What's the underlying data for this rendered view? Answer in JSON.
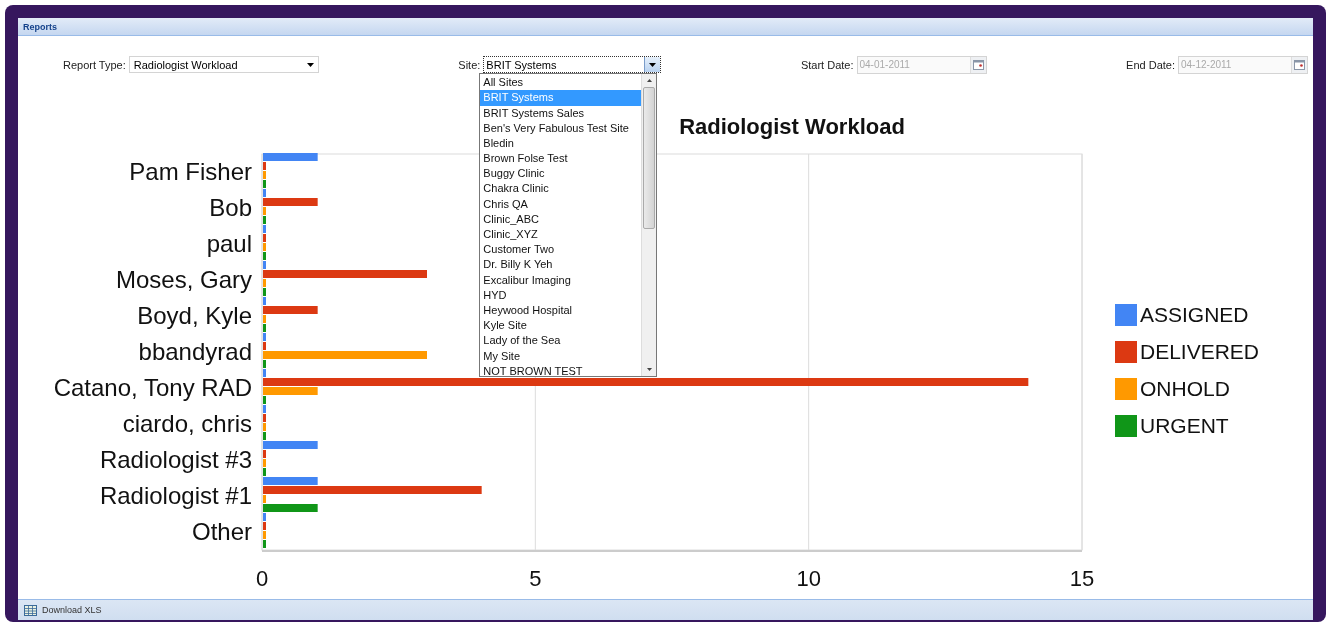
{
  "panel": {
    "title": "Reports"
  },
  "filters": [
    {
      "kind": "select",
      "label": "Report Type:",
      "value": "Radiologist Workload",
      "focused": false
    },
    {
      "kind": "select",
      "label": "Site:",
      "value": "BRIT Systems",
      "focused": true
    },
    {
      "kind": "date",
      "label": "Start Date:",
      "value": "04-01-2011",
      "disabled": true
    },
    {
      "kind": "date",
      "label": "End Date:",
      "value": "04-12-2011",
      "disabled": true
    }
  ],
  "site_list": [
    {
      "label": "All Sites",
      "selected": false
    },
    {
      "label": "BRIT Systems",
      "selected": true
    },
    {
      "label": "BRIT Systems Sales",
      "selected": false
    },
    {
      "label": "Ben's Very Fabulous Test Site",
      "selected": false
    },
    {
      "label": "Bledin",
      "selected": false
    },
    {
      "label": "Brown Folse Test",
      "selected": false
    },
    {
      "label": "Buggy Clinic",
      "selected": false
    },
    {
      "label": "Chakra Clinic",
      "selected": false
    },
    {
      "label": "Chris QA",
      "selected": false
    },
    {
      "label": "Clinic_ABC",
      "selected": false
    },
    {
      "label": "Clinic_XYZ",
      "selected": false
    },
    {
      "label": "Customer Two",
      "selected": false
    },
    {
      "label": "Dr. Billy K Yeh",
      "selected": false
    },
    {
      "label": "Excalibur Imaging",
      "selected": false
    },
    {
      "label": "HYD",
      "selected": false
    },
    {
      "label": "Heywood Hospital",
      "selected": false
    },
    {
      "label": "Kyle Site",
      "selected": false
    },
    {
      "label": "Lady of the Sea",
      "selected": false
    },
    {
      "label": "My Site",
      "selected": false
    },
    {
      "label": "NOT BROWN TEST",
      "selected": false
    }
  ],
  "chart": {
    "chart_data": {
      "type": "bar",
      "orientation": "horizontal",
      "title": "Radiologist Workload",
      "categories": [
        "Pam Fisher",
        "Bob",
        "paul",
        "Moses, Gary",
        "Boyd, Kyle",
        "bbandyrad",
        "Catano, Tony RAD",
        "ciardo, chris",
        "Radiologist #3",
        "Radiologist #1",
        "Other"
      ],
      "xlim": [
        0,
        15
      ],
      "legend": true,
      "xticks": [
        0,
        5,
        10,
        15
      ],
      "series": [
        {
          "name": "ASSIGNED",
          "color": "#4285f4",
          "values": [
            1,
            0,
            0,
            0,
            0,
            0,
            0,
            0,
            1,
            1,
            0
          ]
        },
        {
          "name": "DELIVERED",
          "color": "#dc3912",
          "values": [
            0,
            1,
            0,
            3,
            1,
            0,
            14,
            0,
            0,
            4,
            0
          ]
        },
        {
          "name": "ONHOLD",
          "color": "#ff9900",
          "values": [
            0,
            0,
            0,
            0,
            0,
            3,
            1,
            0,
            0,
            0,
            0
          ]
        },
        {
          "name": "URGENT",
          "color": "#109618",
          "values": [
            0,
            0,
            0,
            0,
            0,
            0,
            0,
            0,
            0,
            1,
            0
          ]
        }
      ]
    }
  },
  "footer": {
    "button": "Download XLS"
  }
}
